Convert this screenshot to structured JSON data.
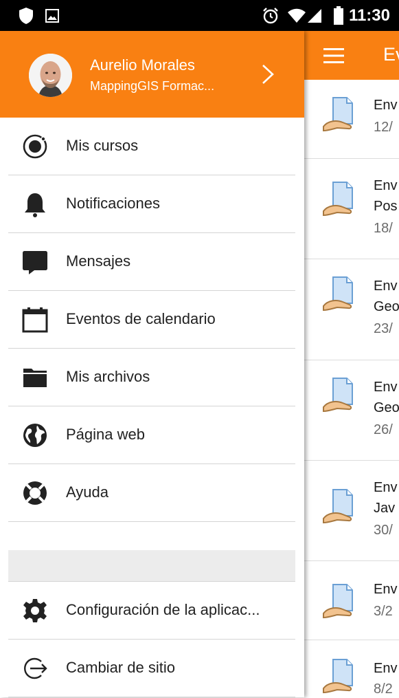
{
  "status_bar": {
    "time": "11:30",
    "icons": [
      "shield-icon",
      "image-icon",
      "alarm-icon",
      "wifi-icon",
      "signal-icon",
      "battery-icon"
    ]
  },
  "background_app": {
    "title": "Ev",
    "menu_icon": "hamburger-icon",
    "items": [
      {
        "line1": "Env",
        "line2": "",
        "date": "12/"
      },
      {
        "line1": "Env",
        "line2": "Pos",
        "date": "18/"
      },
      {
        "line1": "Env",
        "line2": "Geo",
        "date": "23/"
      },
      {
        "line1": "Env",
        "line2": "Geo",
        "date": "26/"
      },
      {
        "line1": "Env",
        "line2": "Jav",
        "date": "30/"
      },
      {
        "line1": "Env",
        "line2": "",
        "date": "3/2"
      },
      {
        "line1": "Env",
        "line2": "",
        "date": "8/2"
      }
    ]
  },
  "drawer": {
    "user_name": "Aurelio Morales",
    "site_name": "MappingGIS Formac...",
    "items": [
      {
        "label": "Mis cursos",
        "icon": "courses-icon"
      },
      {
        "label": "Notificaciones",
        "icon": "bell-icon"
      },
      {
        "label": "Mensajes",
        "icon": "chat-icon"
      },
      {
        "label": "Eventos de calendario",
        "icon": "calendar-icon"
      },
      {
        "label": "Mis archivos",
        "icon": "folder-icon"
      },
      {
        "label": "Página web",
        "icon": "globe-icon"
      },
      {
        "label": "Ayuda",
        "icon": "help-icon"
      },
      {
        "label": "Configuración de la aplicac...",
        "icon": "gear-icon"
      },
      {
        "label": "Cambiar de sitio",
        "icon": "switch-site-icon"
      }
    ]
  },
  "colors": {
    "accent": "#f98012",
    "text": "#222222",
    "divider": "#d4d4d4"
  }
}
